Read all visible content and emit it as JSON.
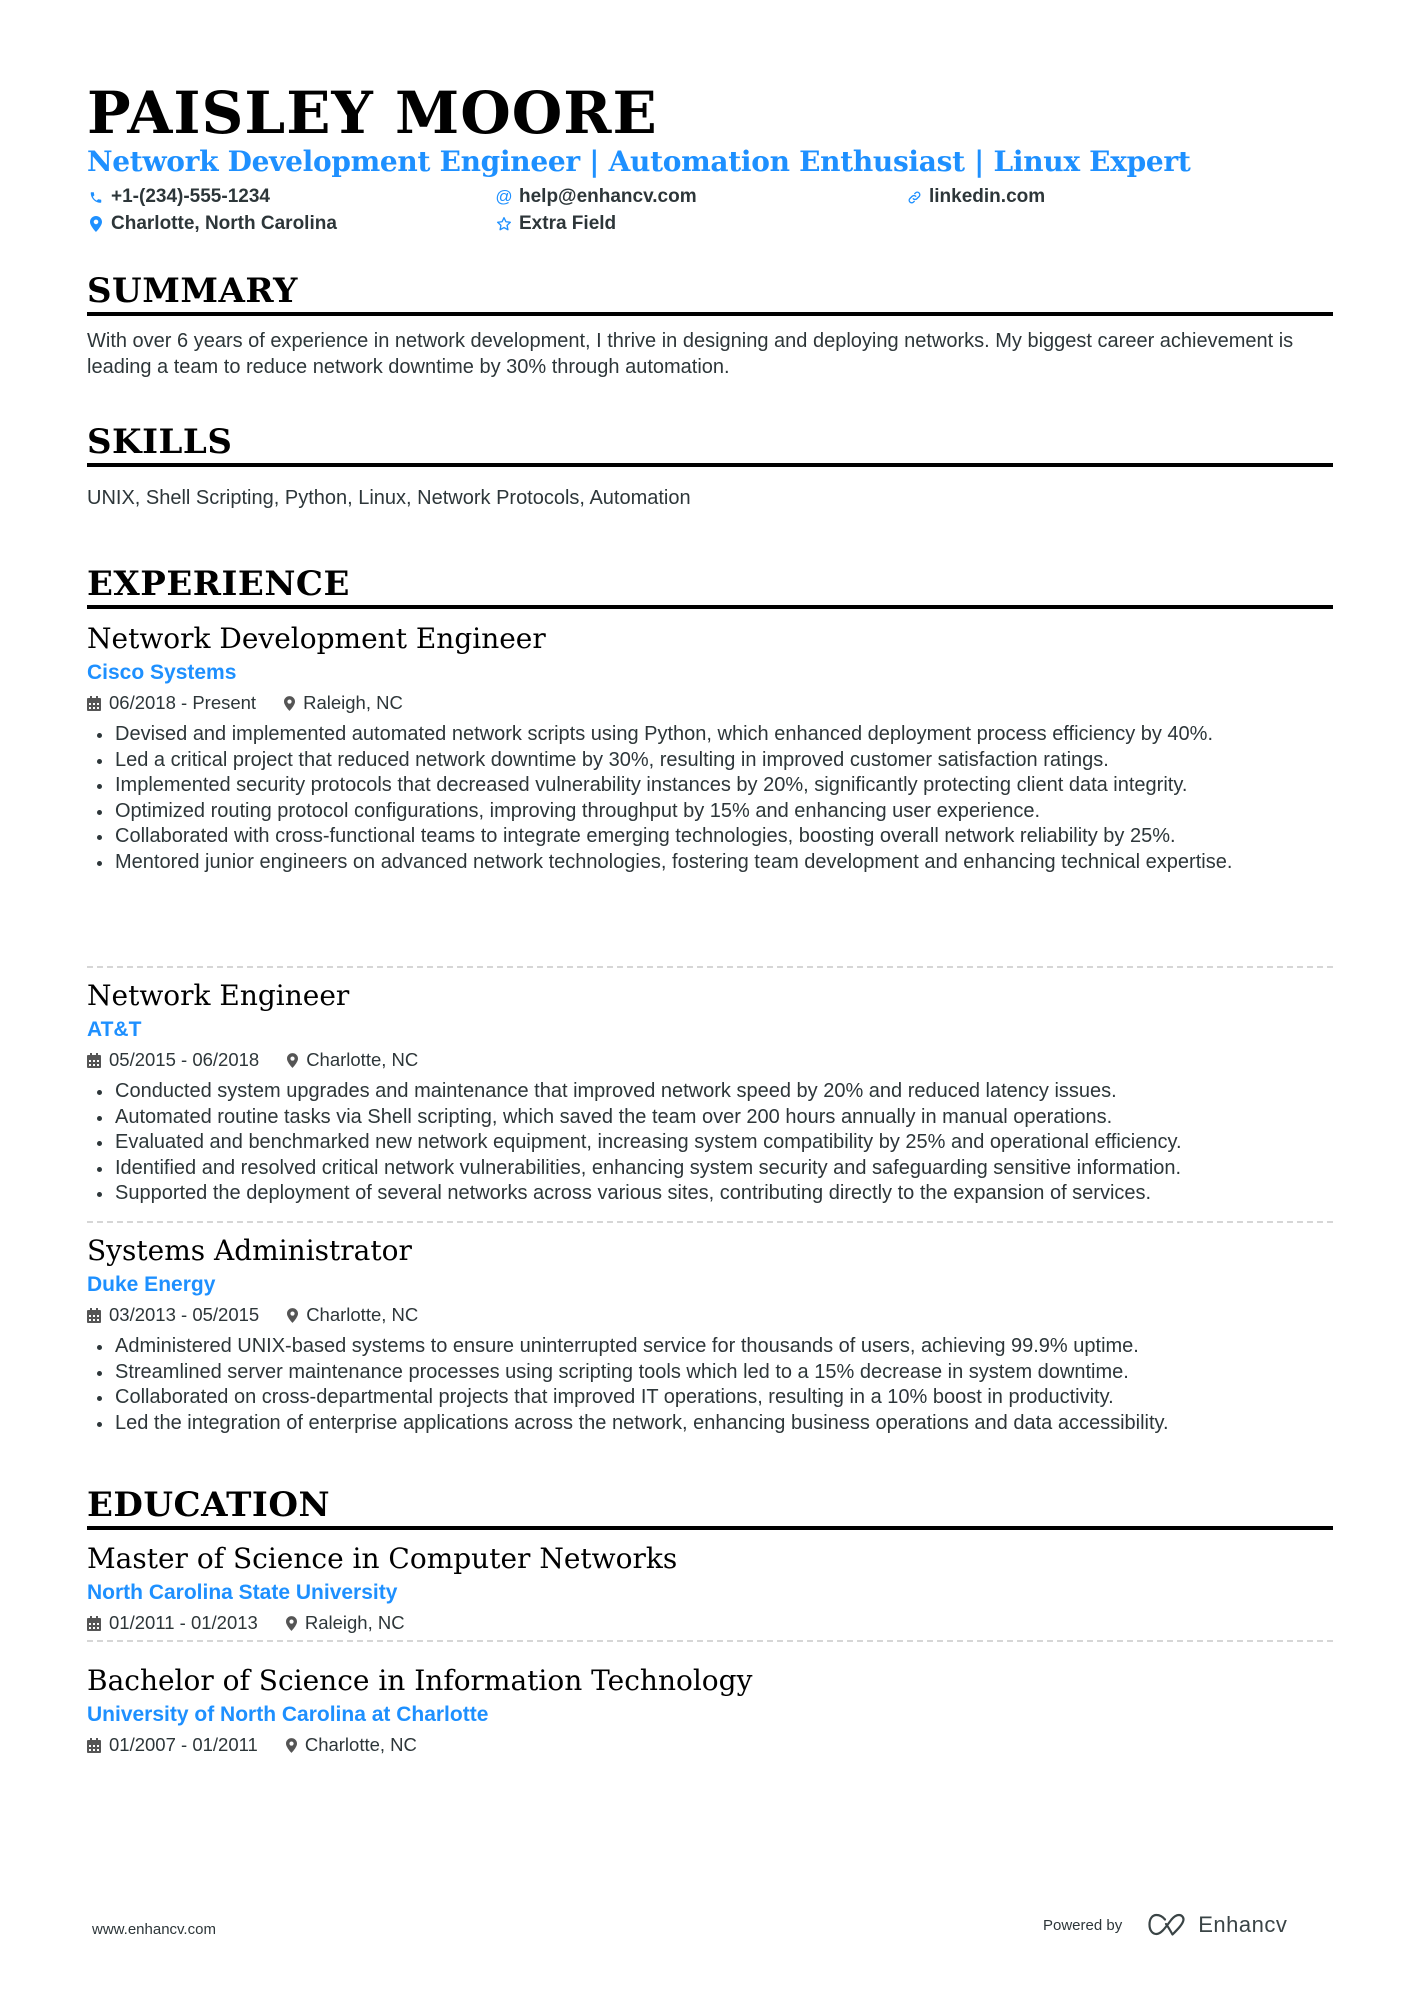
{
  "header": {
    "name": "PAISLEY MOORE",
    "headline": "Network Development Engineer | Automation Enthusiast | Linux Expert",
    "contacts": {
      "phone": "+1-(234)-555-1234",
      "email": "help@enhancv.com",
      "website": "linkedin.com",
      "location": "Charlotte, North Carolina",
      "extra": "Extra Field"
    }
  },
  "summary": {
    "title": "SUMMARY",
    "text": "With over 6 years of experience in network development, I thrive in designing and deploying networks. My biggest career achievement is leading a team to reduce network downtime by 30% through automation."
  },
  "skills": {
    "title": "SKILLS",
    "text": "UNIX, Shell Scripting, Python, Linux, Network Protocols, Automation"
  },
  "experience": {
    "title": "EXPERIENCE",
    "items": [
      {
        "role": "Network Development Engineer",
        "company": "Cisco Systems",
        "dates": "06/2018 - Present",
        "location": "Raleigh, NC",
        "bullets": [
          "Devised and implemented automated network scripts using Python, which enhanced deployment process efficiency by 40%.",
          "Led a critical project that reduced network downtime by 30%, resulting in improved customer satisfaction ratings.",
          "Implemented security protocols that decreased vulnerability instances by 20%, significantly protecting client data integrity.",
          "Optimized routing protocol configurations, improving throughput by 15% and enhancing user experience.",
          "Collaborated with cross-functional teams to integrate emerging technologies, boosting overall network reliability by 25%.",
          "Mentored junior engineers on advanced network technologies, fostering team development and enhancing technical expertise."
        ]
      },
      {
        "role": "Network Engineer",
        "company": "AT&T",
        "dates": "05/2015 - 06/2018",
        "location": "Charlotte, NC",
        "bullets": [
          "Conducted system upgrades and maintenance that improved network speed by 20% and reduced latency issues.",
          "Automated routine tasks via Shell scripting, which saved the team over 200 hours annually in manual operations.",
          "Evaluated and benchmarked new network equipment, increasing system compatibility by 25% and operational efficiency.",
          "Identified and resolved critical network vulnerabilities, enhancing system security and safeguarding sensitive information.",
          "Supported the deployment of several networks across various sites, contributing directly to the expansion of services."
        ]
      },
      {
        "role": "Systems Administrator",
        "company": "Duke Energy",
        "dates": "03/2013 - 05/2015",
        "location": "Charlotte, NC",
        "bullets": [
          "Administered UNIX-based systems to ensure uninterrupted service for thousands of users, achieving 99.9% uptime.",
          "Streamlined server maintenance processes using scripting tools which led to a 15% decrease in system downtime.",
          "Collaborated on cross-departmental projects that improved IT operations, resulting in a 10% boost in productivity.",
          "Led the integration of enterprise applications across the network, enhancing business operations and data accessibility."
        ]
      }
    ]
  },
  "education": {
    "title": "EDUCATION",
    "items": [
      {
        "degree": "Master of Science in Computer Networks",
        "school": "North Carolina State University",
        "dates": "01/2011 - 01/2013",
        "location": "Raleigh, NC"
      },
      {
        "degree": "Bachelor of Science in Information Technology",
        "school": "University of North Carolina at Charlotte",
        "dates": "01/2007 - 01/2011",
        "location": "Charlotte, NC"
      }
    ]
  },
  "footer": {
    "website": "www.enhancv.com",
    "powered_by": "Powered by",
    "brand": "Enhancv"
  },
  "colors": {
    "accent": "#1e90ff",
    "text": "#2d3639",
    "heading": "#000000"
  }
}
